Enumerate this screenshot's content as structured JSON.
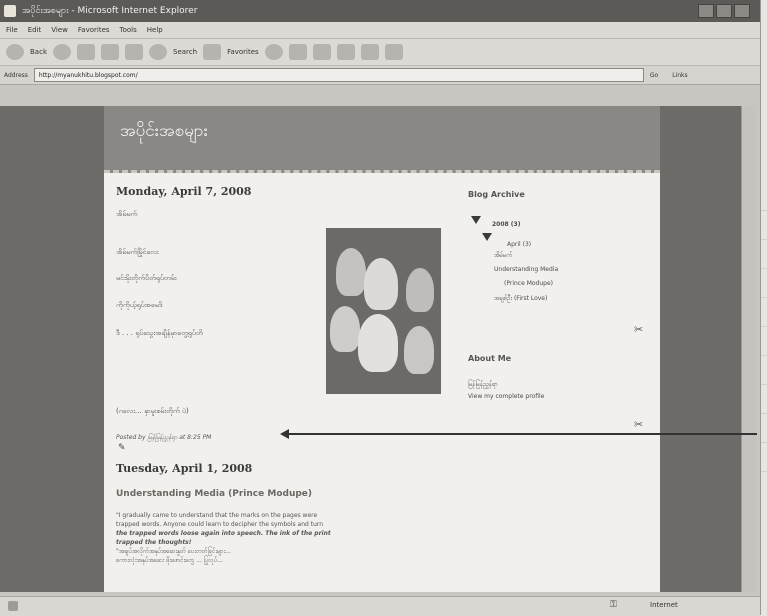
{
  "window": {
    "title": "အပိုင်းအစများ - Microsoft Internet Explorer"
  },
  "menu": [
    "File",
    "Edit",
    "View",
    "Favorites",
    "Tools",
    "Help"
  ],
  "toolbar": {
    "back": "Back",
    "search": "Search",
    "favorites": "Favorites"
  },
  "address": {
    "label": "Address",
    "url": "http://myanukhitu.blogspot.com/",
    "go": "Go",
    "links": "Links"
  },
  "blog": {
    "title": "အပိုင်းအစများ"
  },
  "post1": {
    "date": "Monday, April 7, 2008",
    "lines": [
      "အိမ်မက်",
      "အိမ်မက်မြိုင်လေး",
      "မင်းမိုးတိုက်ပိတ်ရုပ်တမ်း",
      "ကိုကိုယ့်ရုပ်အမေဒိ",
      "ဒီ . . . ရုပ်သွေးအချိန်မှာတွေ့ရုပ်တိ",
      "(ဂလေး… နှာမူးစမ်းတိုက် ပဲ)"
    ],
    "footer": "Posted by မြန်မြန်ညွှန်ရာ at 8:25 PM"
  },
  "post2": {
    "date": "Tuesday, April 1, 2008",
    "title": "Understanding Media (Prince Modupe)",
    "body": [
      "\"I gradually came to understand that the marks on the pages were",
      "trapped words. Anyone could learn to decipher the symbols and turn",
      "the trapped words loose again into speech. The ink of the print",
      "trapped the thoughts!",
      "\"အချပ်အလိုက်အနုပ်အဆေးနှုတ် ပေးတတ်ခြင်းများ...",
      "စကားလုံးအနုပ်အဆေး ဖိုးဖောင်းတွေ ... ပြုလုပ်..."
    ]
  },
  "sidebar": {
    "archive_title": "Blog Archive",
    "archive": [
      "2008 (3)",
      "April (3)",
      "အိမ်မက်",
      "Understanding Media",
      "(Prince Modupe)",
      "အချစ်ဦး (First Love)"
    ],
    "about_title": "About Me",
    "about_name": "မြန်မြန်ညွှန်ရာ",
    "profile_link": "View my complete profile"
  },
  "status": {
    "zone": "Internet"
  }
}
